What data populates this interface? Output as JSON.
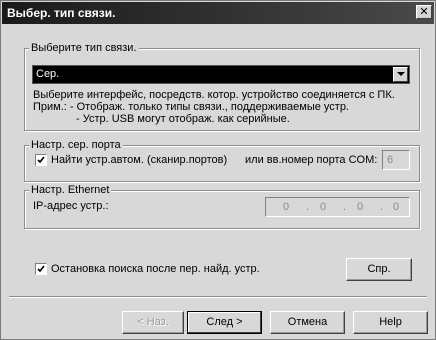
{
  "window": {
    "title": "Выбер. тип связи.",
    "close_glyph": "✕"
  },
  "conn_type": {
    "legend": "Выберите тип связи.",
    "selected": "Сер.",
    "info_line1": "Выберите интерфейс, посредств. котор. устройство соединяется с ПК.",
    "info_line2": "Прим.:  - Отображ. только типы связи., поддерживаемые устр.",
    "info_line3": "- Устр. USB могут отображ. как серийные."
  },
  "serial": {
    "legend": "Настр. сер. порта",
    "auto_label": "Найти устр.автом. (сканир.портов)",
    "auto_checked": true,
    "com_label": "или вв.номер порта COM:",
    "com_value": "6"
  },
  "ethernet": {
    "legend": "Настр. Ethernet",
    "ip_label": "IP-адрес устр.:",
    "ip_octets": [
      "0",
      "0",
      "0",
      "0"
    ]
  },
  "stop_search": {
    "label": "Остановка поиска после пер. найд. устр.",
    "checked": true
  },
  "buttons": {
    "help_small": "Спр.",
    "back": "< Наз.",
    "next": "След >",
    "cancel": "Отмена",
    "help": "Help"
  }
}
